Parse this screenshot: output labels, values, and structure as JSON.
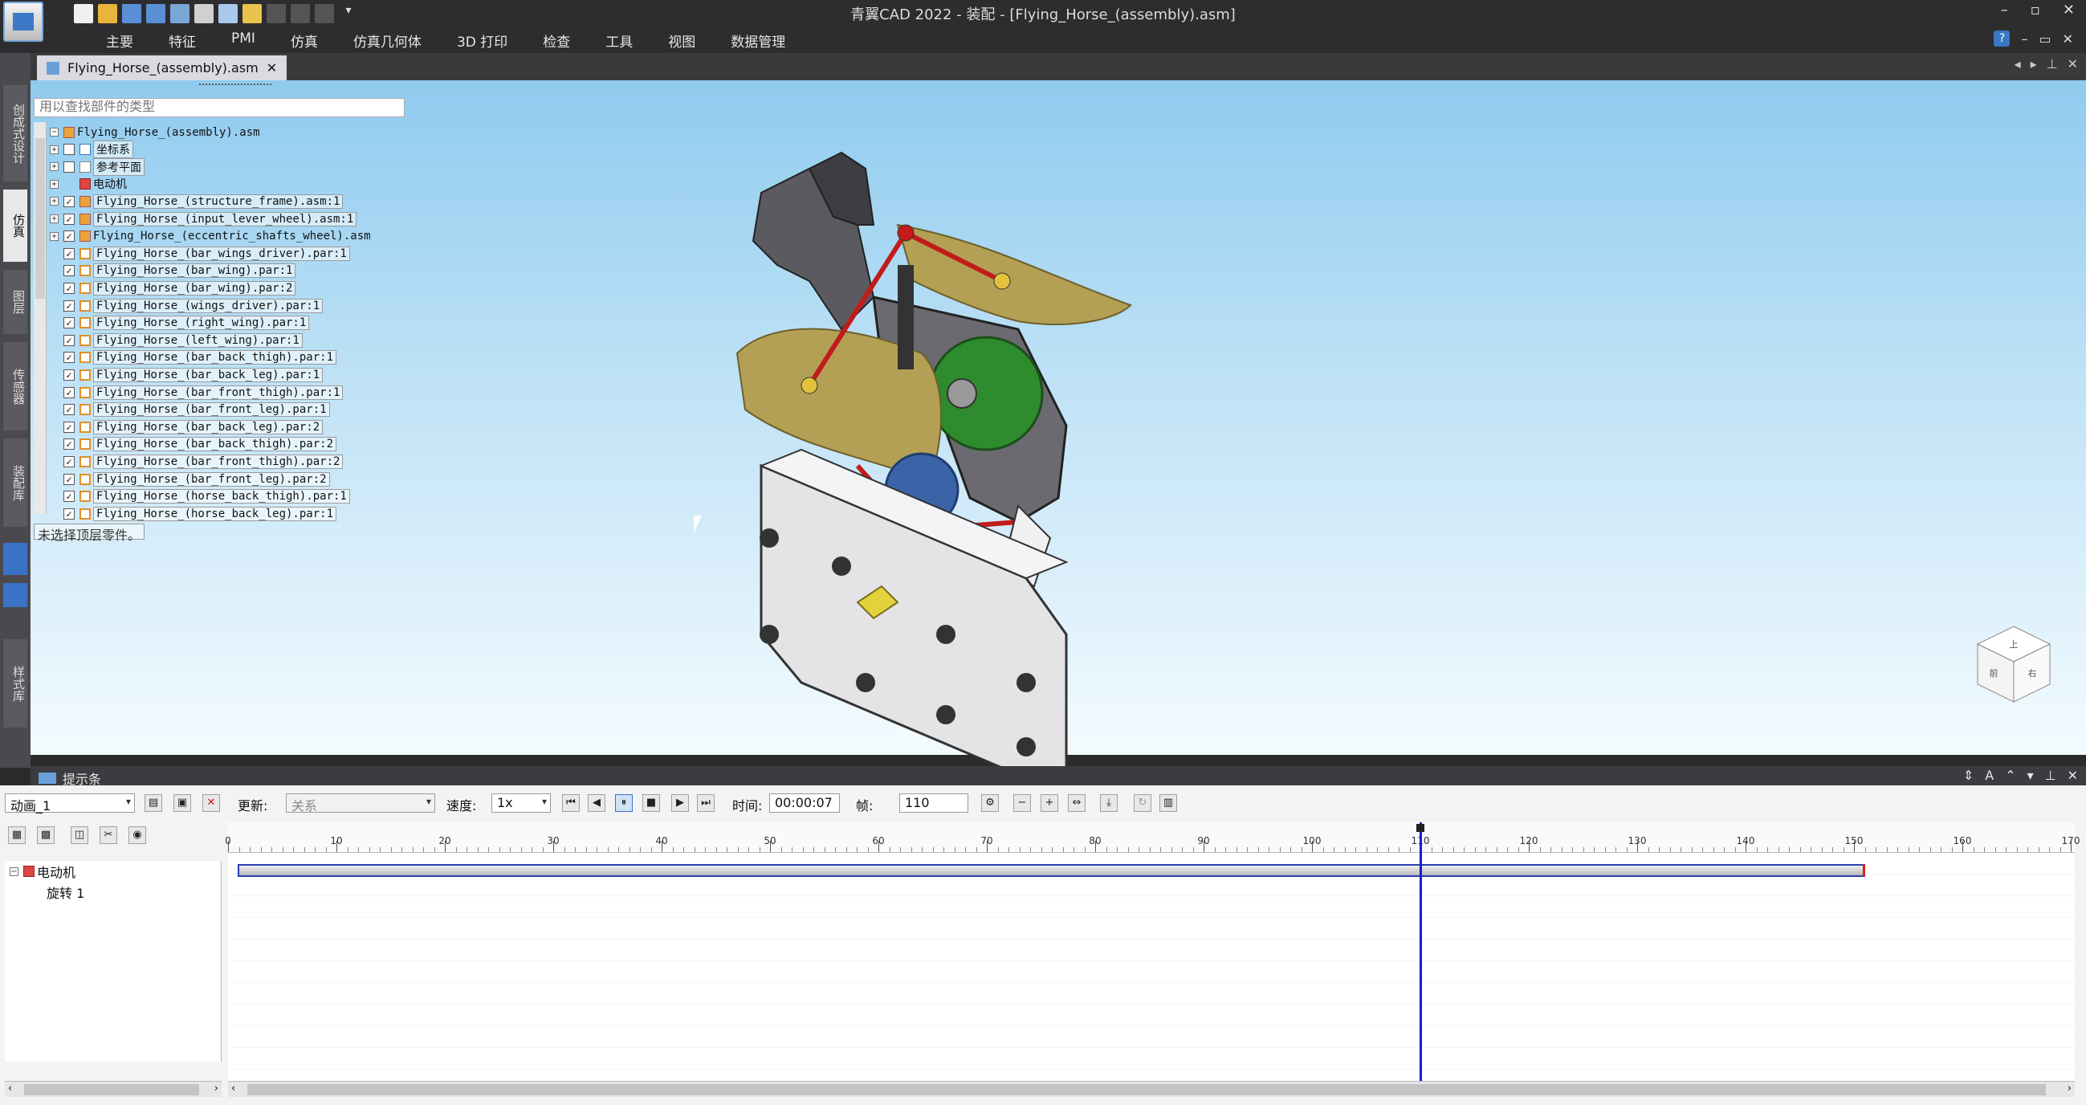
{
  "window": {
    "title": "青翼CAD 2022 - 装配 - [Flying_Horse_(assembly).asm]",
    "controls": [
      "–",
      "▫",
      "✕"
    ]
  },
  "ribbon": {
    "tabs": [
      "主要",
      "特征",
      "PMI",
      "仿真",
      "仿真几何体",
      "3D 打印",
      "检查",
      "工具",
      "视图",
      "数据管理"
    ],
    "help": "?",
    "minimize": "–",
    "restore": "▭",
    "close": "✕"
  },
  "doc_tab": {
    "label": "Flying_Horse_(assembly).asm",
    "close": "✕"
  },
  "left_strip": {
    "tabs": [
      "创成式设计",
      "仿真",
      "图层",
      "传感器",
      "装配库",
      "样式库"
    ]
  },
  "pathfinder": {
    "search_placeholder": "用以查找部件的类型",
    "status": "未选择顶层零件。",
    "root": "Flying_Horse_(assembly).asm",
    "items": [
      {
        "label": "坐标系",
        "exp": "+",
        "check": "",
        "icon": "coord",
        "boxed": true
      },
      {
        "label": "参考平面",
        "exp": "+",
        "check": "",
        "icon": "plane",
        "boxed": true
      },
      {
        "label": "电动机",
        "exp": "+",
        "check": "none",
        "icon": "motor",
        "boxed": false
      },
      {
        "label": "Flying_Horse_(structure_frame).asm:1",
        "exp": "+",
        "check": "✓",
        "icon": "asm",
        "boxed": true
      },
      {
        "label": "Flying_Horse_(input_lever_wheel).asm:1",
        "exp": "+",
        "check": "✓",
        "icon": "asm",
        "boxed": true
      },
      {
        "label": "Flying_Horse_(eccentric_shafts_wheel).asm",
        "exp": "+",
        "check": "✓",
        "icon": "asm",
        "boxed": false
      },
      {
        "label": "Flying_Horse_(bar_wings_driver).par:1",
        "exp": "",
        "check": "✓",
        "icon": "par",
        "boxed": true
      },
      {
        "label": "Flying_Horse_(bar_wing).par:1",
        "exp": "",
        "check": "✓",
        "icon": "par",
        "boxed": true
      },
      {
        "label": "Flying_Horse_(bar_wing).par:2",
        "exp": "",
        "check": "✓",
        "icon": "par",
        "boxed": true
      },
      {
        "label": "Flying_Horse_(wings_driver).par:1",
        "exp": "",
        "check": "✓",
        "icon": "par",
        "boxed": true
      },
      {
        "label": "Flying_Horse_(right_wing).par:1",
        "exp": "",
        "check": "✓",
        "icon": "par",
        "boxed": true
      },
      {
        "label": "Flying_Horse_(left_wing).par:1",
        "exp": "",
        "check": "✓",
        "icon": "par",
        "boxed": true
      },
      {
        "label": "Flying_Horse_(bar_back_thigh).par:1",
        "exp": "",
        "check": "✓",
        "icon": "par",
        "boxed": true
      },
      {
        "label": "Flying_Horse_(bar_back_leg).par:1",
        "exp": "",
        "check": "✓",
        "icon": "par",
        "boxed": true
      },
      {
        "label": "Flying_Horse_(bar_front_thigh).par:1",
        "exp": "",
        "check": "✓",
        "icon": "par",
        "boxed": true
      },
      {
        "label": "Flying_Horse_(bar_front_leg).par:1",
        "exp": "",
        "check": "✓",
        "icon": "par",
        "boxed": true
      },
      {
        "label": "Flying_Horse_(bar_back_leg).par:2",
        "exp": "",
        "check": "✓",
        "icon": "par",
        "boxed": true
      },
      {
        "label": "Flying_Horse_(bar_back_thigh).par:2",
        "exp": "",
        "check": "✓",
        "icon": "par",
        "boxed": true
      },
      {
        "label": "Flying_Horse_(bar_front_thigh).par:2",
        "exp": "",
        "check": "✓",
        "icon": "par",
        "boxed": true
      },
      {
        "label": "Flying_Horse_(bar_front_leg).par:2",
        "exp": "",
        "check": "✓",
        "icon": "par",
        "boxed": true
      },
      {
        "label": "Flying_Horse_(horse_back_thigh).par:1",
        "exp": "",
        "check": "✓",
        "icon": "par",
        "boxed": true
      },
      {
        "label": "Flying_Horse_(horse_back_leg).par:1",
        "exp": "",
        "check": "✓",
        "icon": "par",
        "boxed": true
      }
    ]
  },
  "view_cube": {
    "faces": [
      "前",
      "右",
      "上"
    ]
  },
  "prompt_bar": {
    "title": "提示条"
  },
  "animation": {
    "name": "动画_1",
    "update_label": "更新:",
    "update_value": "关系",
    "speed_label": "速度:",
    "speed_value": "1x",
    "time_label": "时间:",
    "time_value": "00:00:07",
    "frame_label": "帧:",
    "frame_value": "110",
    "ruler_max": 170,
    "current_frame": 110,
    "track_start": 0,
    "track_end": 151,
    "tree": [
      {
        "label": "电动机",
        "exp": "−"
      },
      {
        "label": "旋转 1",
        "exp": ""
      }
    ]
  },
  "colors": {
    "accent": "#3a73c5",
    "playhead": "#1b1bd1",
    "track_end": "#e21b1b",
    "wing": "#b3a055",
    "gear_green": "#2e8b2e",
    "frame_gray": "#d8d8d8"
  }
}
